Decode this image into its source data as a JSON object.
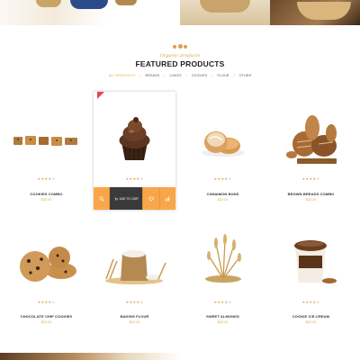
{
  "heading": {
    "subtitle": "Organic products",
    "title": "FEATURED PRODUCTS"
  },
  "filters": [
    {
      "label": "ALL PRODUCTS",
      "active": true
    },
    {
      "label": "BREADS",
      "active": false
    },
    {
      "label": "CAKES",
      "active": false
    },
    {
      "label": "COOKIES",
      "active": false
    },
    {
      "label": "FLOUR",
      "active": false
    },
    {
      "label": "OTHER",
      "active": false
    }
  ],
  "products": [
    {
      "name": "COOKIES COMBO",
      "price": "$23.00",
      "rating": 4
    },
    {
      "name": "",
      "price": "",
      "rating": 4,
      "highlighted": true,
      "cart_label": "ADD TO CART"
    },
    {
      "name": "CINNAMON BUNS",
      "price": "$23.00",
      "rating": 4
    },
    {
      "name": "BROWN BREADS COMBO",
      "price": "$23.00",
      "rating": 4
    },
    {
      "name": "CHOCOLATE CHIP COOKIES",
      "price": "$23.00",
      "rating": 4
    },
    {
      "name": "BAKING FLOUR",
      "price": "$23.00",
      "rating": 4
    },
    {
      "name": "SWEET ALMONDS",
      "price": "$23.00",
      "rating": 4
    },
    {
      "name": "COOKIE ICE-CREAM",
      "price": "$23.00",
      "rating": 4
    }
  ],
  "colors": {
    "accent": "#f7a74a",
    "price": "#e0a94a",
    "active_filter": "#f1a13a",
    "cart_button": "#3a3a3a"
  },
  "icons": {
    "search": "search-icon",
    "cart": "cart-icon",
    "heart": "heart-icon",
    "compare": "bar-chart-icon"
  }
}
